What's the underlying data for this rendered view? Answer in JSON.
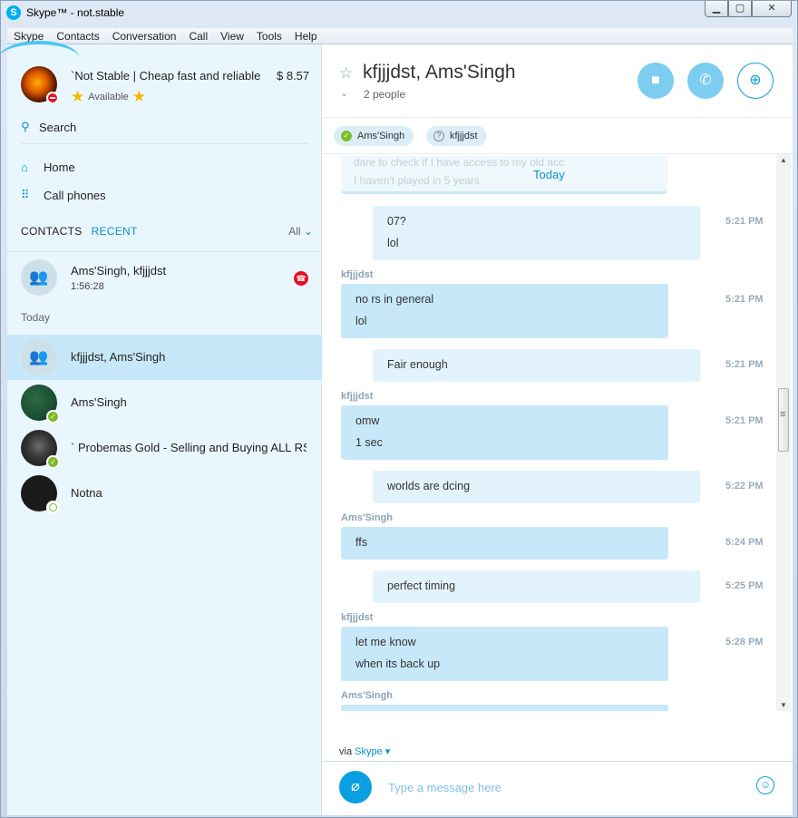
{
  "window": {
    "title": "Skype™ - not.stable",
    "minimize": "▁",
    "maximize": "▢",
    "close": "✕"
  },
  "menu": [
    "Skype",
    "Contacts",
    "Conversation",
    "Call",
    "View",
    "Tools",
    "Help"
  ],
  "profile": {
    "name": "`Not Stable | Cheap fast and reliable",
    "credit": "$ 8.57",
    "status": "Available"
  },
  "nav": {
    "search": "Search",
    "home": "Home",
    "call_phones": "Call phones"
  },
  "tabs": {
    "contacts": "CONTACTS",
    "recent": "RECENT",
    "filter": "All"
  },
  "recent": [
    {
      "name": "Ams'Singh, kfjjjdst",
      "sub": "1:56:28",
      "avatar": "group-icon",
      "badge": "end-call-icon"
    }
  ],
  "section_today": "Today",
  "today_list": [
    {
      "name": "kfjjjdst, Ams'Singh",
      "avatar": "group-icon",
      "selected": true
    },
    {
      "name": "Ams'Singh",
      "avatar": "chalkboard-avatar",
      "presence": "online"
    },
    {
      "name": "` Probemas Gold - Selling and Buying ALL RS",
      "avatar": "game-avatar",
      "presence": "online"
    },
    {
      "name": "Notna",
      "avatar": "dark-avatar",
      "presence": "offline"
    }
  ],
  "conversation": {
    "title": "kfjjjdst, Ams'Singh",
    "people": "2 people",
    "participants": [
      {
        "name": "Ams'Singh",
        "status": "online"
      },
      {
        "name": "kfjjjdst",
        "status": "unknown"
      }
    ],
    "ghost_lines": [
      "dare to check if I have access to my old acc",
      "I haven't played in 5 years"
    ],
    "day_label": "Today",
    "messages": [
      {
        "from": "me",
        "sender": "",
        "lines": [
          "07?",
          "lol"
        ],
        "time": "5:21 PM"
      },
      {
        "from": "them",
        "sender": "kfjjjdst",
        "lines": [
          "no rs in general",
          "lol"
        ],
        "time": "5:21 PM"
      },
      {
        "from": "me",
        "sender": "",
        "lines": [
          "Fair enough"
        ],
        "time": "5:21 PM"
      },
      {
        "from": "them",
        "sender": "kfjjjdst",
        "lines": [
          "omw",
          "1 sec"
        ],
        "time": "5:21 PM"
      },
      {
        "from": "me",
        "sender": "",
        "lines": [
          "worlds are dcing"
        ],
        "time": "5:22 PM"
      },
      {
        "from": "them",
        "sender": "Ams'Singh",
        "lines": [
          "ffs"
        ],
        "time": "5:24 PM"
      },
      {
        "from": "me",
        "sender": "",
        "lines": [
          "perfect timing"
        ],
        "time": "5:25 PM"
      },
      {
        "from": "them",
        "sender": "kfjjjdst",
        "lines": [
          "let me know",
          "when its back up"
        ],
        "time": "5:28 PM"
      },
      {
        "from": "them",
        "sender": "Ams'Singh",
        "lines": [
          ""
        ],
        "time": ""
      }
    ]
  },
  "via": {
    "prefix": "via",
    "service": "Skype"
  },
  "compose": {
    "placeholder": "Type a message here"
  },
  "colors": {
    "accent": "#0a9fe0",
    "bubble_mine": "#e3f3fb",
    "bubble_theirs": "#c7e8f8",
    "selected": "#c6e8f8"
  }
}
